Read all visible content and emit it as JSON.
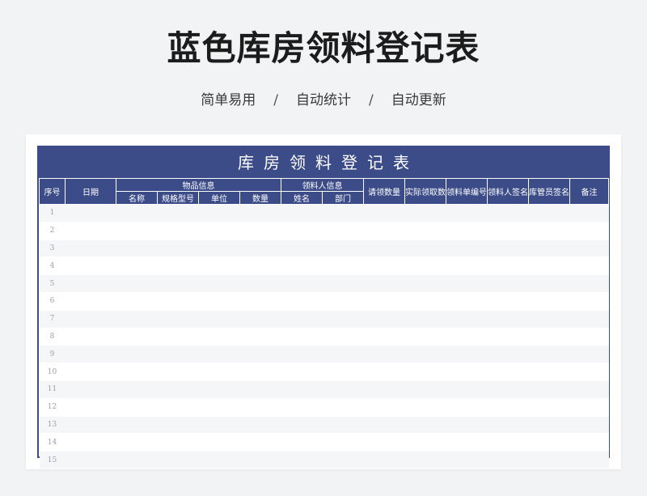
{
  "page": {
    "title": "蓝色库房领料登记表",
    "features": [
      "简单易用",
      "自动统计",
      "自动更新"
    ],
    "separator": "/"
  },
  "sheet": {
    "title": "库房领料登记表",
    "headers": {
      "seq": "序号",
      "date": "日期",
      "item_group": "物品信息",
      "item_name": "名称",
      "item_spec": "规格型号",
      "item_unit": "单位",
      "item_qty": "数量",
      "person_group": "领料人信息",
      "person_name": "姓名",
      "person_dept": "部门",
      "requested_qty": "请领数量",
      "actual_qty": "实际领取数量",
      "form_no": "领料单编号",
      "receiver_sign": "领料人签名",
      "keeper_sign": "库管员签名",
      "remarks": "备注"
    },
    "rows": [
      "1",
      "2",
      "3",
      "4",
      "5",
      "6",
      "7",
      "8",
      "9",
      "10",
      "11",
      "12",
      "13",
      "14",
      "15"
    ]
  },
  "colors": {
    "header_blue": "#3c4c89",
    "stripe": "#f5f6f8",
    "background": "#f2f3f5"
  }
}
